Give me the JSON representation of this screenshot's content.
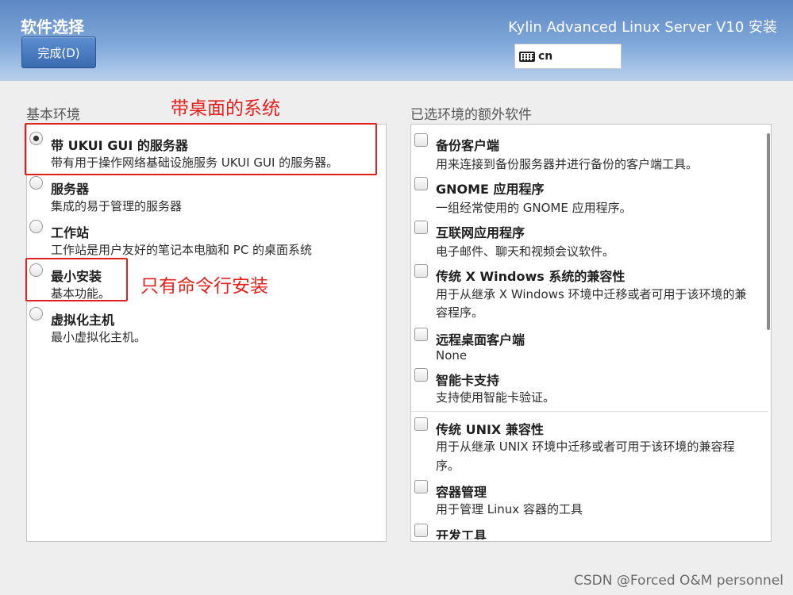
{
  "header": {
    "spoke_title": "软件选择",
    "done_button": "完成(D)",
    "product_title": "Kylin Advanced Linux Server V10 安装",
    "keyboard_layout": "cn"
  },
  "base_env": {
    "label": "基本环境",
    "items": [
      {
        "title": "带 UKUI GUI 的服务器",
        "desc": "带有用于操作网络基础设施服务 UKUI GUI 的服务器。",
        "selected": true
      },
      {
        "title": "服务器",
        "desc": "集成的易于管理的服务器",
        "selected": false
      },
      {
        "title": "工作站",
        "desc": "工作站是用户友好的笔记本电脑和 PC 的桌面系统",
        "selected": false
      },
      {
        "title": "最小安装",
        "desc": "基本功能。",
        "selected": false
      },
      {
        "title": "虚拟化主机",
        "desc": "最小虚拟化主机。",
        "selected": false
      }
    ]
  },
  "addons": {
    "label": "已选环境的额外软件",
    "items": [
      {
        "title": "备份客户端",
        "desc": [
          "用来连接到备份服务器并进行备份的客户端工具。"
        ]
      },
      {
        "title": "GNOME 应用程序",
        "desc": [
          "一组经常使用的 GNOME 应用程序。"
        ]
      },
      {
        "title": "互联网应用程序",
        "desc": [
          "电子邮件、聊天和视频会议软件。"
        ]
      },
      {
        "title": "传统 X Windows 系统的兼容性",
        "desc": [
          "用于从继承 X Windows 环境中迁移或者可用于该环境的兼",
          "容程序。"
        ]
      },
      {
        "title": "远程桌面客户端",
        "desc": [
          "None"
        ]
      },
      {
        "title": "智能卡支持",
        "desc": [
          "支持使用智能卡验证。"
        ]
      },
      {
        "title": "传统 UNIX 兼容性",
        "desc": [
          "用于从继承 UNIX 环境中迁移或者可用于该环境的兼容程",
          "序。"
        ]
      },
      {
        "title": "容器管理",
        "desc": [
          "用于管理 Linux 容器的工具"
        ]
      },
      {
        "title": "开发工具",
        "desc": []
      }
    ]
  },
  "annotations": {
    "desktop_note": "带桌面的系统",
    "cli_note": "只有命令行安装"
  },
  "watermark": "CSDN @Forced O&M personnel",
  "colors": {
    "accent": "#3a6bb1",
    "annotation_red": "#e0201c"
  }
}
